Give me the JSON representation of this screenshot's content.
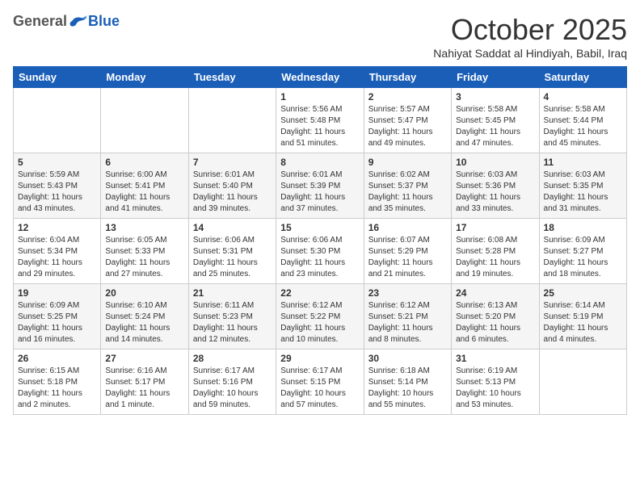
{
  "header": {
    "logo_general": "General",
    "logo_blue": "Blue",
    "month": "October 2025",
    "location": "Nahiyat Saddat al Hindiyah, Babil, Iraq"
  },
  "weekdays": [
    "Sunday",
    "Monday",
    "Tuesday",
    "Wednesday",
    "Thursday",
    "Friday",
    "Saturday"
  ],
  "weeks": [
    [
      {
        "day": "",
        "info": ""
      },
      {
        "day": "",
        "info": ""
      },
      {
        "day": "",
        "info": ""
      },
      {
        "day": "1",
        "info": "Sunrise: 5:56 AM\nSunset: 5:48 PM\nDaylight: 11 hours\nand 51 minutes."
      },
      {
        "day": "2",
        "info": "Sunrise: 5:57 AM\nSunset: 5:47 PM\nDaylight: 11 hours\nand 49 minutes."
      },
      {
        "day": "3",
        "info": "Sunrise: 5:58 AM\nSunset: 5:45 PM\nDaylight: 11 hours\nand 47 minutes."
      },
      {
        "day": "4",
        "info": "Sunrise: 5:58 AM\nSunset: 5:44 PM\nDaylight: 11 hours\nand 45 minutes."
      }
    ],
    [
      {
        "day": "5",
        "info": "Sunrise: 5:59 AM\nSunset: 5:43 PM\nDaylight: 11 hours\nand 43 minutes."
      },
      {
        "day": "6",
        "info": "Sunrise: 6:00 AM\nSunset: 5:41 PM\nDaylight: 11 hours\nand 41 minutes."
      },
      {
        "day": "7",
        "info": "Sunrise: 6:01 AM\nSunset: 5:40 PM\nDaylight: 11 hours\nand 39 minutes."
      },
      {
        "day": "8",
        "info": "Sunrise: 6:01 AM\nSunset: 5:39 PM\nDaylight: 11 hours\nand 37 minutes."
      },
      {
        "day": "9",
        "info": "Sunrise: 6:02 AM\nSunset: 5:37 PM\nDaylight: 11 hours\nand 35 minutes."
      },
      {
        "day": "10",
        "info": "Sunrise: 6:03 AM\nSunset: 5:36 PM\nDaylight: 11 hours\nand 33 minutes."
      },
      {
        "day": "11",
        "info": "Sunrise: 6:03 AM\nSunset: 5:35 PM\nDaylight: 11 hours\nand 31 minutes."
      }
    ],
    [
      {
        "day": "12",
        "info": "Sunrise: 6:04 AM\nSunset: 5:34 PM\nDaylight: 11 hours\nand 29 minutes."
      },
      {
        "day": "13",
        "info": "Sunrise: 6:05 AM\nSunset: 5:33 PM\nDaylight: 11 hours\nand 27 minutes."
      },
      {
        "day": "14",
        "info": "Sunrise: 6:06 AM\nSunset: 5:31 PM\nDaylight: 11 hours\nand 25 minutes."
      },
      {
        "day": "15",
        "info": "Sunrise: 6:06 AM\nSunset: 5:30 PM\nDaylight: 11 hours\nand 23 minutes."
      },
      {
        "day": "16",
        "info": "Sunrise: 6:07 AM\nSunset: 5:29 PM\nDaylight: 11 hours\nand 21 minutes."
      },
      {
        "day": "17",
        "info": "Sunrise: 6:08 AM\nSunset: 5:28 PM\nDaylight: 11 hours\nand 19 minutes."
      },
      {
        "day": "18",
        "info": "Sunrise: 6:09 AM\nSunset: 5:27 PM\nDaylight: 11 hours\nand 18 minutes."
      }
    ],
    [
      {
        "day": "19",
        "info": "Sunrise: 6:09 AM\nSunset: 5:25 PM\nDaylight: 11 hours\nand 16 minutes."
      },
      {
        "day": "20",
        "info": "Sunrise: 6:10 AM\nSunset: 5:24 PM\nDaylight: 11 hours\nand 14 minutes."
      },
      {
        "day": "21",
        "info": "Sunrise: 6:11 AM\nSunset: 5:23 PM\nDaylight: 11 hours\nand 12 minutes."
      },
      {
        "day": "22",
        "info": "Sunrise: 6:12 AM\nSunset: 5:22 PM\nDaylight: 11 hours\nand 10 minutes."
      },
      {
        "day": "23",
        "info": "Sunrise: 6:12 AM\nSunset: 5:21 PM\nDaylight: 11 hours\nand 8 minutes."
      },
      {
        "day": "24",
        "info": "Sunrise: 6:13 AM\nSunset: 5:20 PM\nDaylight: 11 hours\nand 6 minutes."
      },
      {
        "day": "25",
        "info": "Sunrise: 6:14 AM\nSunset: 5:19 PM\nDaylight: 11 hours\nand 4 minutes."
      }
    ],
    [
      {
        "day": "26",
        "info": "Sunrise: 6:15 AM\nSunset: 5:18 PM\nDaylight: 11 hours\nand 2 minutes."
      },
      {
        "day": "27",
        "info": "Sunrise: 6:16 AM\nSunset: 5:17 PM\nDaylight: 11 hours\nand 1 minute."
      },
      {
        "day": "28",
        "info": "Sunrise: 6:17 AM\nSunset: 5:16 PM\nDaylight: 10 hours\nand 59 minutes."
      },
      {
        "day": "29",
        "info": "Sunrise: 6:17 AM\nSunset: 5:15 PM\nDaylight: 10 hours\nand 57 minutes."
      },
      {
        "day": "30",
        "info": "Sunrise: 6:18 AM\nSunset: 5:14 PM\nDaylight: 10 hours\nand 55 minutes."
      },
      {
        "day": "31",
        "info": "Sunrise: 6:19 AM\nSunset: 5:13 PM\nDaylight: 10 hours\nand 53 minutes."
      },
      {
        "day": "",
        "info": ""
      }
    ]
  ]
}
